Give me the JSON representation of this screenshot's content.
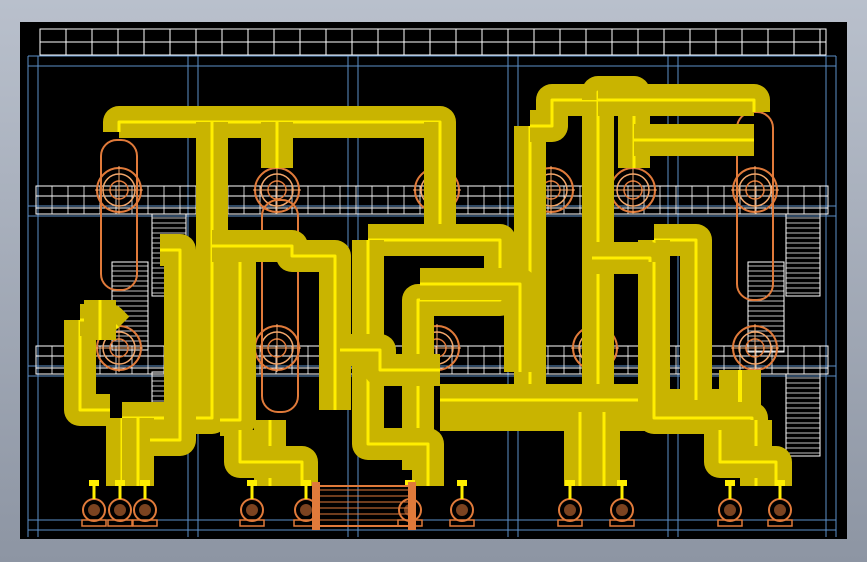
{
  "colors": {
    "background_outer_top": "#b9c0cc",
    "background_outer_bottom": "#8d95a3",
    "viewport_bg": "#000000",
    "grid_blue": "#5b8fc9",
    "structure_white": "#ffffff",
    "pipe_yellow": "#ffee00",
    "pipe_yellow_dark": "#c9b400",
    "vessel_orange": "#e07a3a",
    "vessel_orange_light": "#f2a66a"
  },
  "diagram": {
    "kind": "process-piping-elevation",
    "vessel_rows": 2,
    "vessels_per_row": 6,
    "pump_groups": 5,
    "has_heat_exchanger": true,
    "has_stairs": true,
    "top_railing": true
  }
}
